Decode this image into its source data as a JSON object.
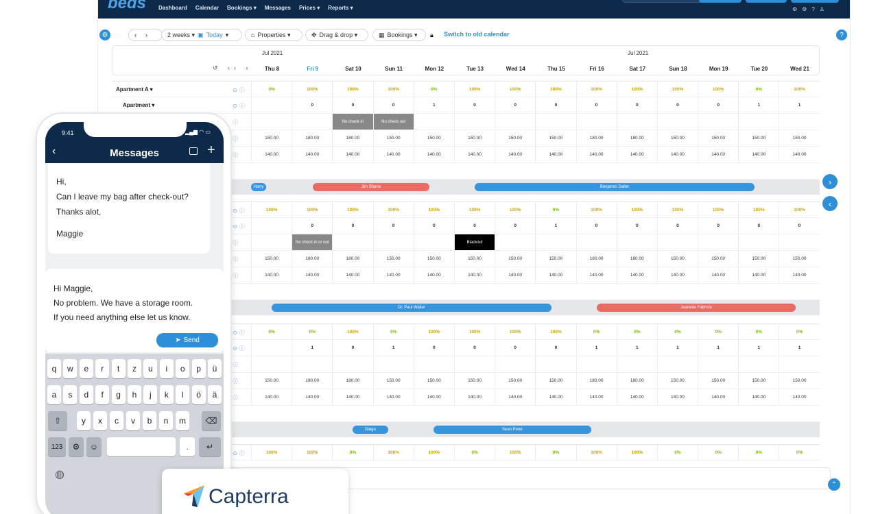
{
  "app": {
    "logo": "beds"
  },
  "nav": {
    "items": [
      "Dashboard",
      "Calendar",
      "Bookings ▾",
      "Messages",
      "Prices ▾",
      "Reports ▾"
    ]
  },
  "toolbar": {
    "range": "2 weeks ▾",
    "today": "Today",
    "properties": "Properties ▾",
    "dragdrop": "Drag & drop ▾",
    "bookings": "Bookings ▾",
    "old_calendar": "Switch to old calendar"
  },
  "calendar": {
    "month_left": "Jul 2021",
    "month_right": "Jul 2021",
    "days": [
      "Thu 8",
      "Fri 9",
      "Sat 10",
      "Sun 11",
      "Mon 12",
      "Tue 13",
      "Wed 14",
      "Thu 15",
      "Fri 16",
      "Sat 17",
      "Sun 18",
      "Mon 19",
      "Tue 20",
      "Wed 21"
    ],
    "row_labels": {
      "apartment_a": "Apartment A ▾",
      "apartment": "Apartment ▾"
    },
    "blocks": [
      {
        "occupancy": [
          "0%",
          "100%",
          "100%",
          "100%",
          "0%",
          "100%",
          "100%",
          "100%",
          "100%",
          "100%",
          "100%",
          "100%",
          "0%",
          "100%"
        ],
        "avail": [
          "",
          "0",
          "0",
          "0",
          "1",
          "0",
          "0",
          "0",
          "0",
          "0",
          "0",
          "0",
          "1",
          "1"
        ],
        "notes": [
          "",
          "",
          "No check in",
          "No check out",
          "",
          "",
          "",
          "",
          "",
          "",
          "",
          "",
          "",
          ""
        ],
        "price1": [
          "150.00",
          "180.00",
          "180.00",
          "150.00",
          "150.00",
          "150.00",
          "150.00",
          "150.00",
          "180.00",
          "180.00",
          "150.00",
          "150.00",
          "150.00",
          "150.00"
        ],
        "price2": [
          "140.00",
          "140.00",
          "140.00",
          "140.00",
          "140.00",
          "140.00",
          "140.00",
          "140.00",
          "140.00",
          "140.00",
          "140.00",
          "140.00",
          "140.00",
          "140.00"
        ],
        "bookings": [
          {
            "name": "Harry",
            "color": "blue"
          },
          {
            "name": "Jim Shane",
            "color": "red"
          },
          {
            "name": "Benjamin Daller",
            "color": "blue"
          }
        ]
      },
      {
        "occupancy": [
          "100%",
          "100%",
          "100%",
          "100%",
          "100%",
          "100%",
          "100%",
          "0%",
          "100%",
          "100%",
          "100%",
          "100%",
          "100%",
          "100%"
        ],
        "avail": [
          "",
          "0",
          "0",
          "0",
          "0",
          "0",
          "0",
          "1",
          "0",
          "0",
          "0",
          "0",
          "0",
          "0"
        ],
        "notes": [
          "",
          "No check in or out",
          "",
          "",
          "",
          "Blackout",
          "",
          "",
          "",
          "",
          "",
          "",
          "",
          ""
        ],
        "price1": [
          "150.00",
          "180.00",
          "180.00",
          "150.00",
          "150.00",
          "150.00",
          "150.00",
          "150.00",
          "180.00",
          "180.00",
          "150.00",
          "150.00",
          "150.00",
          "150.00"
        ],
        "price2": [
          "140.00",
          "140.00",
          "140.00",
          "140.00",
          "140.00",
          "140.00",
          "140.00",
          "140.00",
          "140.00",
          "140.00",
          "140.00",
          "140.00",
          "140.00",
          "140.00"
        ],
        "bookings": [
          {
            "name": "Dr. Paul Walter",
            "color": "blue"
          },
          {
            "name": "Jeanette Fabricio",
            "color": "red"
          }
        ]
      },
      {
        "occupancy": [
          "0%",
          "0%",
          "100%",
          "0%",
          "100%",
          "100%",
          "100%",
          "100%",
          "0%",
          "0%",
          "0%",
          "0%",
          "0%",
          "0%"
        ],
        "avail": [
          "",
          "1",
          "0",
          "1",
          "0",
          "0",
          "0",
          "0",
          "1",
          "1",
          "1",
          "1",
          "1",
          "1"
        ],
        "notes": [
          "",
          "",
          "",
          "",
          "",
          "",
          "",
          "",
          "",
          "",
          "",
          "",
          "",
          ""
        ],
        "price1": [
          "150.00",
          "180.00",
          "180.00",
          "150.00",
          "150.00",
          "150.00",
          "150.00",
          "150.00",
          "180.00",
          "180.00",
          "150.00",
          "150.00",
          "150.00",
          "150.00"
        ],
        "price2": [
          "140.00",
          "140.00",
          "140.00",
          "140.00",
          "140.00",
          "140.00",
          "140.00",
          "140.00",
          "140.00",
          "140.00",
          "140.00",
          "140.00",
          "140.00",
          "140.00"
        ],
        "bookings": [
          {
            "name": "Diego",
            "color": "blue"
          },
          {
            "name": "Sean Peter",
            "color": "blue"
          }
        ]
      },
      {
        "occupancy": [
          "100%",
          "100%",
          "0%",
          "100%",
          "100%",
          "0%",
          "100%",
          "0%",
          "100%",
          "100%",
          "0%",
          "0%",
          "0%",
          "0%"
        ]
      }
    ]
  },
  "phone": {
    "time": "9:41",
    "title": "Messages",
    "incoming": [
      "Hi,",
      "Can I leave my bag after check-out?",
      "Thanks alot,",
      "Maggie"
    ],
    "reply": [
      "Hi Maggie,",
      "No problem. We have a storage room.",
      "If you need anything else let us know."
    ],
    "send": "Send",
    "keys_row1": [
      "q",
      "w",
      "e",
      "r",
      "t",
      "z",
      "u",
      "i",
      "o",
      "p",
      "ü"
    ],
    "keys_row2": [
      "a",
      "s",
      "d",
      "f",
      "g",
      "h",
      "j",
      "k",
      "l",
      "ö",
      "ä"
    ],
    "keys_row3": [
      "y",
      "x",
      "c",
      "v",
      "b",
      "n",
      "m"
    ],
    "key_123": "123",
    "key_dot": "."
  },
  "capterra": {
    "name": "Capterra",
    "colors": {
      "blue": "#1f3a5f",
      "orange": "#ff9d28",
      "lightblue": "#68c5ed",
      "red": "#ff3d2e"
    }
  },
  "colors": {
    "navy": "#0e2a4a",
    "accent": "#2d8fd8",
    "booking_blue": "#3795dc",
    "booking_red": "#ea6a64",
    "occupancy": "#c8a400"
  }
}
